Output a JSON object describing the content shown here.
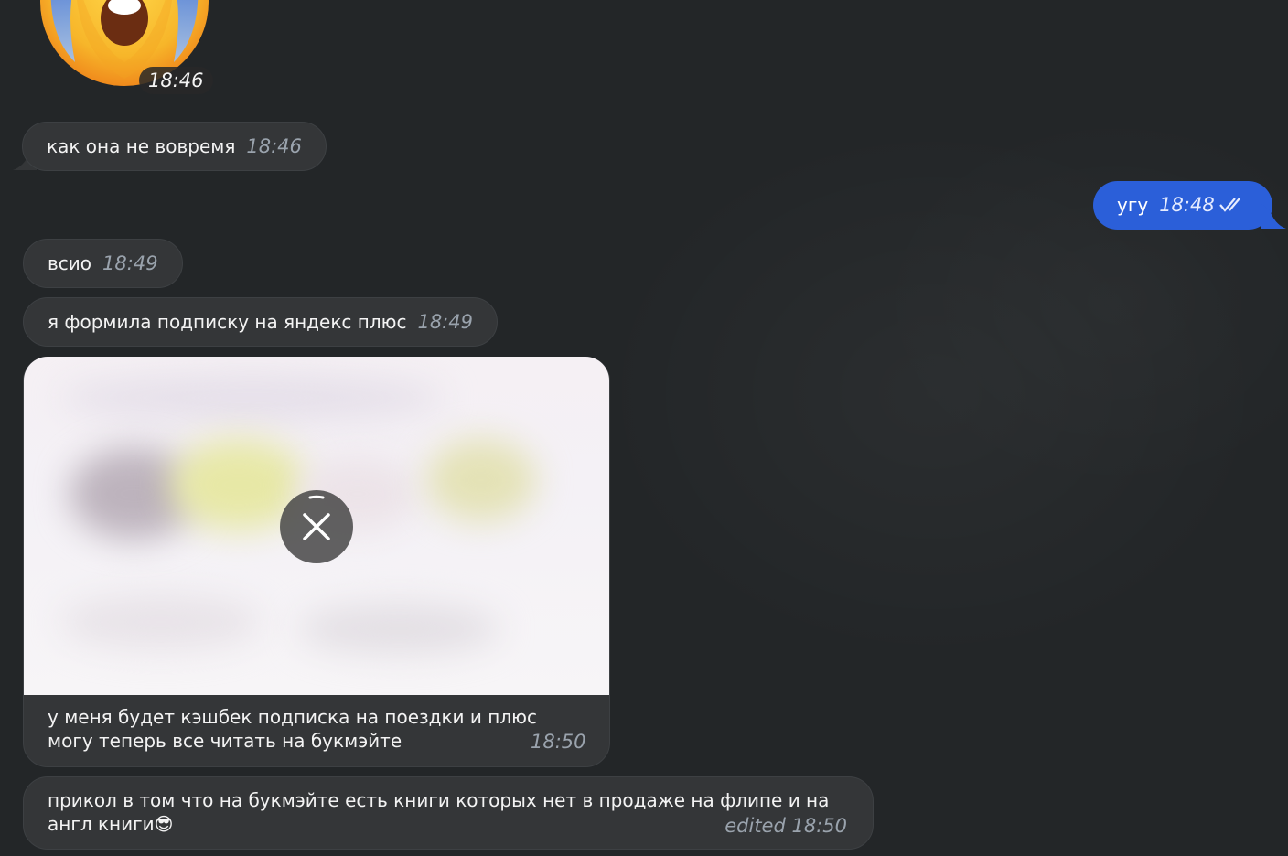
{
  "sticker": {
    "emoji": "scream-emoji",
    "time": "18:46"
  },
  "messages": [
    {
      "text": "как она не вовремя",
      "time": "18:46"
    },
    {
      "text": "угу",
      "time": "18:48",
      "status_icon": "double-check-icon"
    },
    {
      "text": "всио",
      "time": "18:49"
    },
    {
      "text": "я формила подписку на яндекс плюс",
      "time": "18:49"
    },
    {
      "caption_line1": "у меня будет кэшбек подписка на поездки и плюс",
      "caption_line2": "могу теперь все читать на букмэйте",
      "time": "18:50",
      "media_state": "download-cancel"
    },
    {
      "line1": "прикол в том что на букмэйте есть книги которых нет в продаже на флипе и на",
      "line2": "англ книги",
      "emoji": "😎",
      "time": "edited 18:50"
    }
  ],
  "colors": {
    "background": "#232628",
    "incoming": "#343638",
    "outgoing": "#2b5fd9",
    "time": "#9aa3ad"
  }
}
